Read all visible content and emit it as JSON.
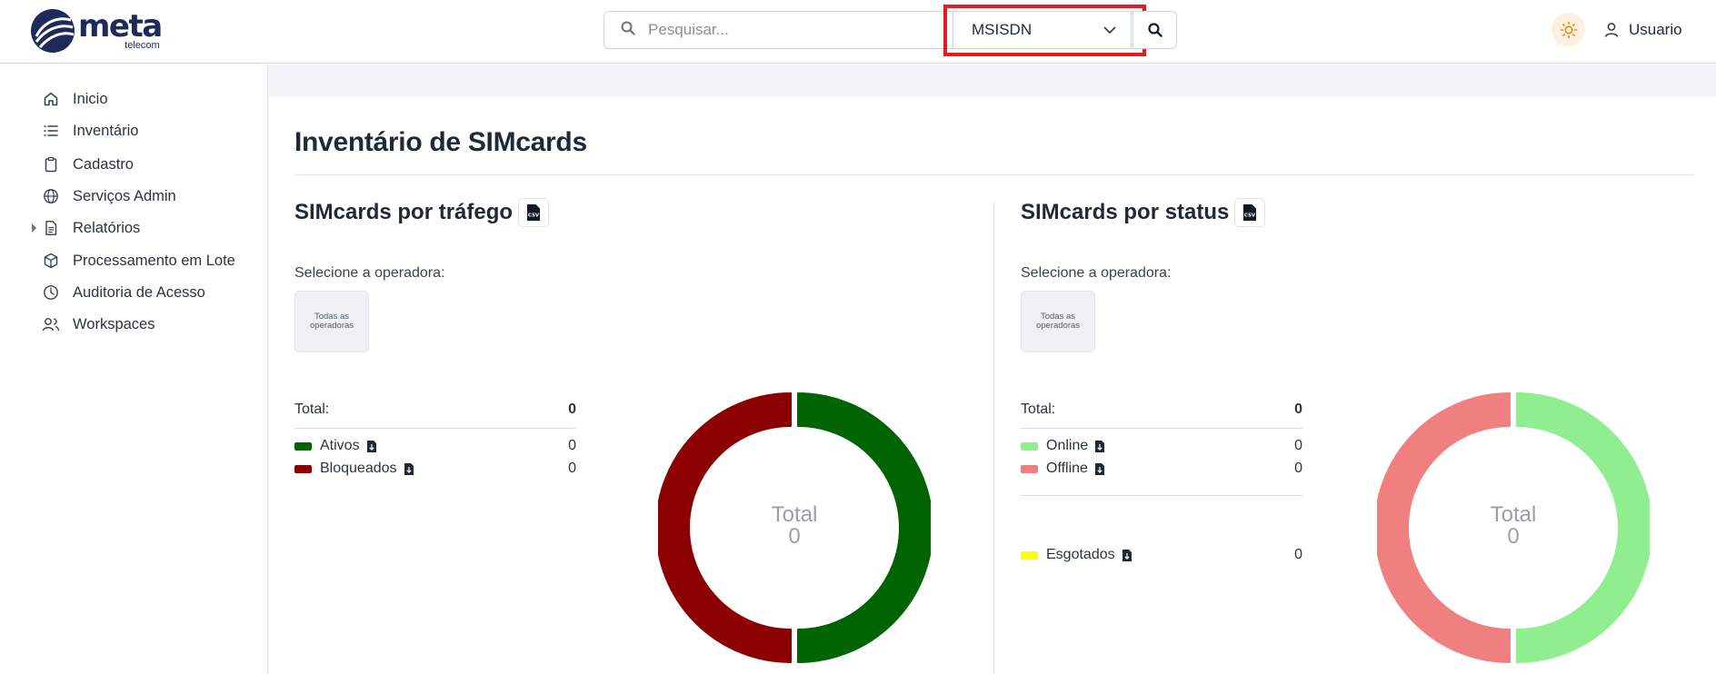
{
  "brand": {
    "name": "meta",
    "sub": "telecom"
  },
  "search": {
    "placeholder": "Pesquisar...",
    "value": "",
    "type_selected": "MSISDN"
  },
  "user": {
    "label": "Usuario"
  },
  "sidebar": {
    "items": [
      {
        "label": "Inicio",
        "icon": "home-icon"
      },
      {
        "label": "Inventário",
        "icon": "list-icon"
      },
      {
        "label": "Cadastro",
        "icon": "clipboard-icon"
      },
      {
        "label": "Serviços Admin",
        "icon": "globe-icon"
      },
      {
        "label": "Relatórios",
        "icon": "document-icon"
      },
      {
        "label": "Processamento em Lote",
        "icon": "box-icon"
      },
      {
        "label": "Auditoria de Acesso",
        "icon": "clock-icon"
      },
      {
        "label": "Workspaces",
        "icon": "users-icon"
      }
    ]
  },
  "page": {
    "title": "Inventário de SIMcards"
  },
  "traffic": {
    "title": "SIMcards por tráfego",
    "select_label": "Selecione a operadora:",
    "operator_card": "Todas as operadoras",
    "total_label": "Total:",
    "total_value": "0",
    "legend": [
      {
        "label": "Ativos",
        "value": "0",
        "color": "#006400"
      },
      {
        "label": "Bloqueados",
        "value": "0",
        "color": "#8b0000"
      }
    ],
    "donut_label": "Total",
    "donut_value": "0"
  },
  "status": {
    "title": "SIMcards por status",
    "select_label": "Selecione a operadora:",
    "operator_card": "Todas as operadoras",
    "total_label": "Total:",
    "total_value": "0",
    "legend": [
      {
        "label": "Online",
        "value": "0",
        "color": "#90ee90"
      },
      {
        "label": "Offline",
        "value": "0",
        "color": "#f08080"
      }
    ],
    "extra": {
      "label": "Esgotados",
      "value": "0",
      "color": "#ffff00"
    },
    "donut_label": "Total",
    "donut_value": "0"
  },
  "colors": {
    "brand": "#1e2a5a",
    "highlight": "#e01e1e"
  }
}
